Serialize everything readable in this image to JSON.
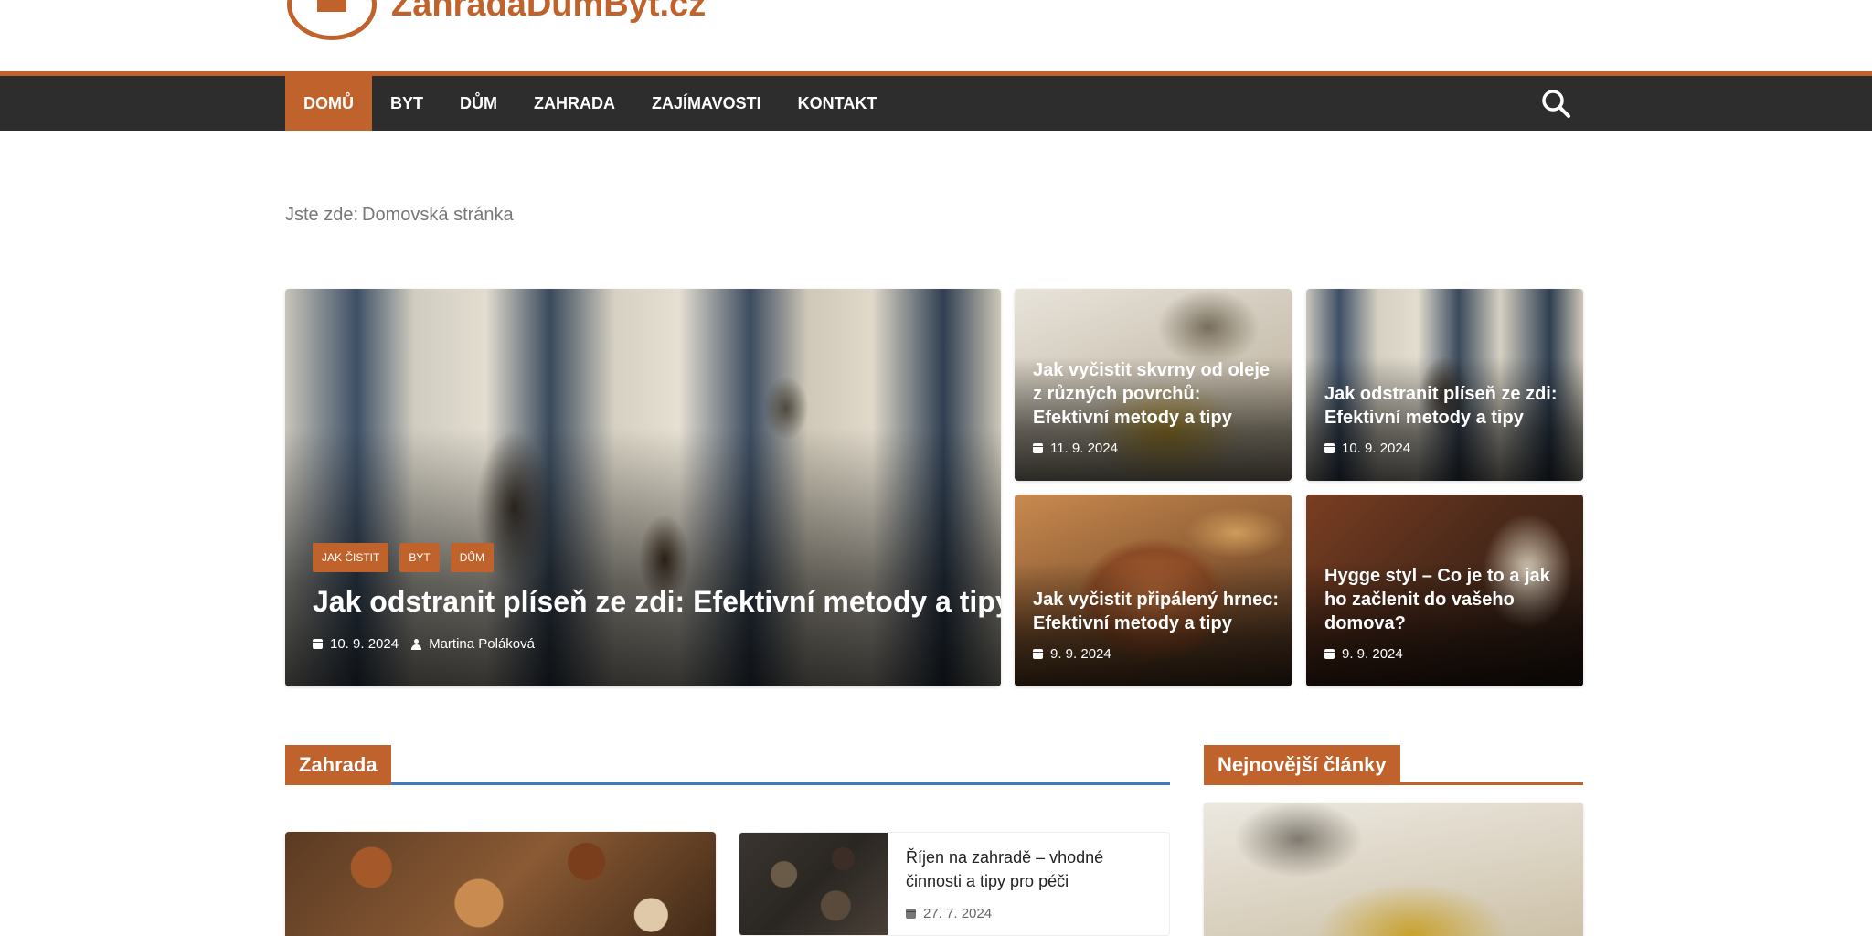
{
  "site": {
    "title": "ZahradaDumByt.cz"
  },
  "colors": {
    "accent": "#c0622b",
    "nav_bg": "#2d2d2e",
    "section_line_blue": "#3b7dbf"
  },
  "nav": {
    "items": [
      {
        "label": "DOMŮ",
        "active": true
      },
      {
        "label": "BYT",
        "active": false
      },
      {
        "label": "DŮM",
        "active": false
      },
      {
        "label": "ZAHRADA",
        "active": false
      },
      {
        "label": "ZAJÍMAVOSTI",
        "active": false
      },
      {
        "label": "KONTAKT",
        "active": false
      }
    ],
    "search_icon": "search-icon"
  },
  "breadcrumb": {
    "prefix": "Jste zde:",
    "current": "Domovská stránka"
  },
  "featured": {
    "main": {
      "tags": [
        "JAK ČISTIT",
        "BYT",
        "DŮM"
      ],
      "title": "Jak odstranit plíseň ze zdi: Efektivní metody a tipy",
      "date": "10. 9. 2024",
      "author": "Martina Poláková"
    },
    "small": [
      {
        "title": "Jak vyčistit skvrny od oleje z různých povrchů: Efektivní metody a tipy",
        "date": "11. 9. 2024"
      },
      {
        "title": "Jak odstranit plíseň ze zdi: Efektivní metody a tipy",
        "date": "10. 9. 2024"
      },
      {
        "title": "Jak vyčistit připálený hrnec: Efektivní metody a tipy",
        "date": "9. 9. 2024"
      },
      {
        "title": "Hygge styl – Co je to a jak ho začlenit do vašeho domova?",
        "date": "9. 9. 2024"
      }
    ]
  },
  "sections": {
    "zahrada": {
      "heading": "Zahrada",
      "list_item": {
        "title": "Říjen na zahradě – vhodné činnosti a tipy pro péči",
        "date": "27. 7. 2024"
      }
    },
    "sidebar": {
      "heading": "Nejnovější články"
    }
  }
}
